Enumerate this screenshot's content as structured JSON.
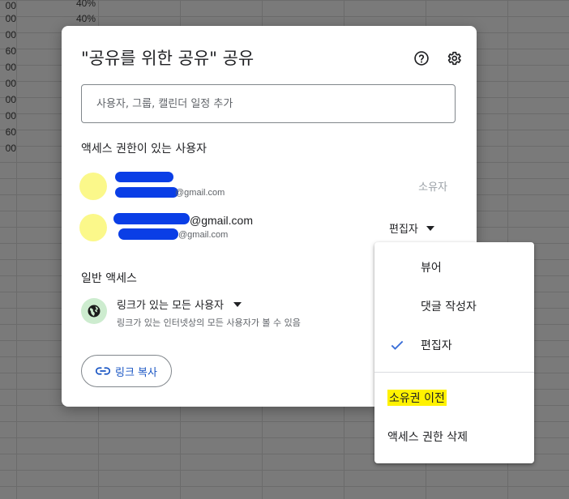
{
  "sheet": {
    "left_column": [
      "00",
      "00",
      "00",
      "60",
      "00",
      "00",
      "00",
      "00",
      "60",
      "00"
    ],
    "percent_column": [
      "40%",
      "40%"
    ]
  },
  "dialog": {
    "title": "\"공유를 위한 공유\" 공유",
    "help_icon": "help-icon",
    "settings_icon": "gear-icon",
    "search_placeholder": "사용자, 그룹, 캘린더 일정 추가",
    "people_section_title": "액세스 권한이 있는 사용자",
    "people": [
      {
        "email_suffix": "@gmail.com",
        "role": "소유자"
      },
      {
        "email_primary_suffix": "@gmail.com",
        "email_suffix": "@gmail.com",
        "role": "편집자"
      }
    ],
    "general_access_title": "일반 액세스",
    "general_access_value": "링크가 있는 모든 사용자",
    "general_access_desc": "링크가 있는 인터넷상의 모든 사용자가 볼 수 있음",
    "copy_link_label": "링크 복사"
  },
  "role_menu": {
    "items": [
      "뷰어",
      "댓글 작성자",
      "편집자"
    ],
    "selected": "편집자",
    "actions": [
      "소유권 이전",
      "액세스 권한 삭제"
    ]
  },
  "colors": {
    "avatar": "#fbf88a",
    "redaction": "#0a3ee6",
    "highlight": "#fff200",
    "accent": "#1a56c4"
  }
}
